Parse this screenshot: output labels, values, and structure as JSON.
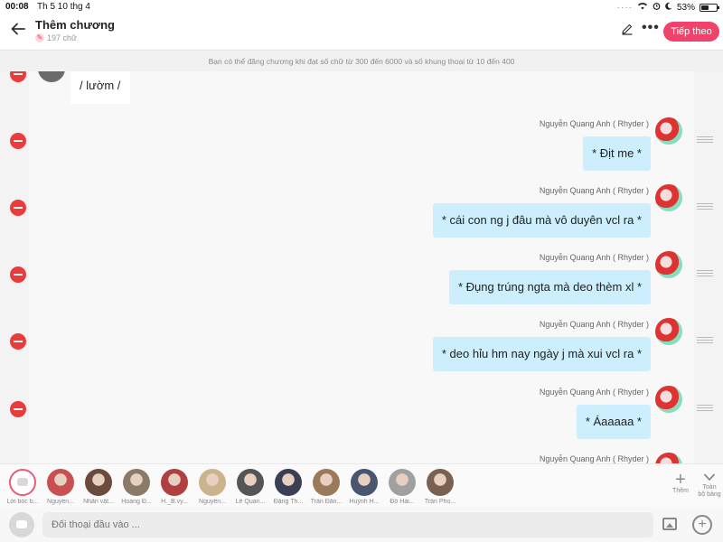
{
  "status_bar": {
    "time": "00:08",
    "date": "Th 5 10 thg 4",
    "battery": "53%",
    "battery_level": 0.53,
    "indicators": "····"
  },
  "header": {
    "title": "Thêm chương",
    "word_count": "197 chữ",
    "next_label": "Tiếp theo",
    "back_icon": "back-arrow-icon",
    "more_label": "•••"
  },
  "notice": "Bạn có thể đăng chương khi đạt số chữ từ 300 đến 6000 và số khung thoại từ 10 đến 400",
  "chat": {
    "partial_message": "/ lườm /",
    "messages": [
      {
        "sender": "Nguyễn Quang Anh ( Rhyder )",
        "text": "* Địt me *"
      },
      {
        "sender": "Nguyễn Quang Anh ( Rhyder )",
        "text": "* cái con ng j đâu mà vô duyên vcl ra *"
      },
      {
        "sender": "Nguyễn Quang Anh ( Rhyder )",
        "text": "* Đụng trúng ngta mà deo thèm xl *"
      },
      {
        "sender": "Nguyễn Quang Anh ( Rhyder )",
        "text": "* deo hỉu hm nay ngày j mà xui vcl ra *"
      },
      {
        "sender": "Nguyễn Quang Anh ( Rhyder )",
        "text": "* Áaaaaa *"
      },
      {
        "sender": "Nguyễn Quang Anh ( Rhyder )",
        "text": ""
      }
    ]
  },
  "characters": [
    {
      "name": "Lời bốc b...",
      "color": "#ffffff"
    },
    {
      "name": "Nguyễn...",
      "color": "#c85050"
    },
    {
      "name": "Nhân vật...",
      "color": "#6b4b3e"
    },
    {
      "name": "Hoàng Đ...",
      "color": "#8a7a6a"
    },
    {
      "name": "H._B.vy...",
      "color": "#b04040"
    },
    {
      "name": "Nguyễn...",
      "color": "#c9b48e"
    },
    {
      "name": "Lê Quan...",
      "color": "#555555"
    },
    {
      "name": "Đặng Th...",
      "color": "#3a3f55"
    },
    {
      "name": "Trần Đăn...",
      "color": "#9a7a5a"
    },
    {
      "name": "Huỳnh H...",
      "color": "#4a5570"
    },
    {
      "name": "Đỗ Hải...",
      "color": "#a0a0a0"
    },
    {
      "name": "Trần Pho...",
      "color": "#7a6050"
    }
  ],
  "char_bar": {
    "add_label": "Thêm",
    "collapse_label_1": "Toàn",
    "collapse_label_2": "bộ bảng"
  },
  "input": {
    "placeholder": "Đối thoại đầu vào ..."
  }
}
